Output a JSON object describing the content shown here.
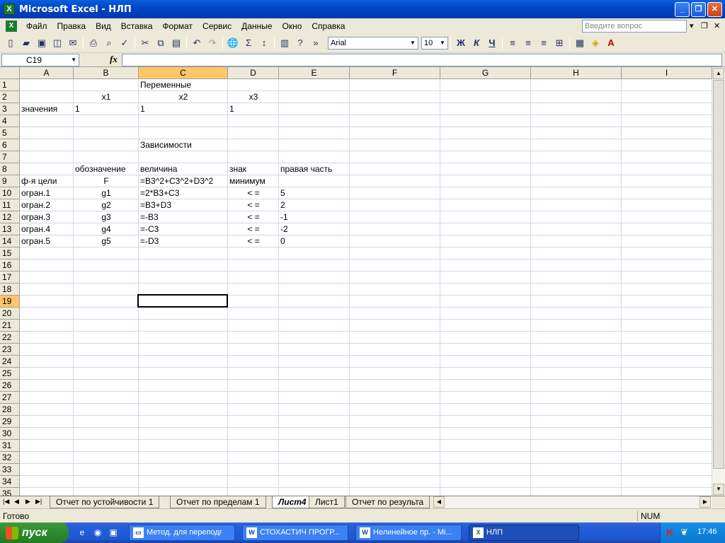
{
  "window": {
    "title": "Microsoft Excel - НЛП",
    "app_icon": "X"
  },
  "menu": {
    "items": [
      "Файл",
      "Правка",
      "Вид",
      "Вставка",
      "Формат",
      "Сервис",
      "Данные",
      "Окно",
      "Справка"
    ],
    "ask_placeholder": "Введите вопрос"
  },
  "toolbar": {
    "font_name": "Arial",
    "font_size": "10",
    "bold_label": "Ж",
    "italic_label": "К",
    "underline_label": "Ч"
  },
  "formula_bar": {
    "name_box": "C19",
    "fx_label": "fx",
    "formula": ""
  },
  "columns": [
    "A",
    "B",
    "C",
    "D",
    "E",
    "F",
    "G",
    "H",
    "I"
  ],
  "selected_column": "C",
  "selected_row": 19,
  "row_count": 35,
  "cells": [
    {
      "ref": "C1",
      "text": "Переменные",
      "align": "left"
    },
    {
      "ref": "B2",
      "text": "x1",
      "align": "center"
    },
    {
      "ref": "C2",
      "text": "x2",
      "align": "center"
    },
    {
      "ref": "D2",
      "text": "x3",
      "align": "center"
    },
    {
      "ref": "A3",
      "text": "значения",
      "align": "left"
    },
    {
      "ref": "B3",
      "text": "1",
      "align": "left"
    },
    {
      "ref": "C3",
      "text": "1",
      "align": "left"
    },
    {
      "ref": "D3",
      "text": "1",
      "align": "left"
    },
    {
      "ref": "C6",
      "text": "Зависимости",
      "align": "left"
    },
    {
      "ref": "B8",
      "text": "обозначение",
      "align": "left"
    },
    {
      "ref": "C8",
      "text": "величина",
      "align": "left"
    },
    {
      "ref": "D8",
      "text": "знак",
      "align": "left"
    },
    {
      "ref": "E8",
      "text": "правая часть",
      "align": "left"
    },
    {
      "ref": "A9",
      "text": "ф-я цели",
      "align": "left"
    },
    {
      "ref": "B9",
      "text": "F",
      "align": "center"
    },
    {
      "ref": "C9",
      "text": "=B3^2+C3^2+D3^2",
      "align": "left"
    },
    {
      "ref": "D9",
      "text": "минимум",
      "align": "left"
    },
    {
      "ref": "A10",
      "text": "огран.1",
      "align": "left"
    },
    {
      "ref": "B10",
      "text": "g1",
      "align": "center"
    },
    {
      "ref": "C10",
      "text": "=2*B3+C3",
      "align": "left"
    },
    {
      "ref": "D10",
      "text": "< =",
      "align": "center"
    },
    {
      "ref": "E10",
      "text": "5",
      "align": "left"
    },
    {
      "ref": "A11",
      "text": "огран.2",
      "align": "left"
    },
    {
      "ref": "B11",
      "text": "g2",
      "align": "center"
    },
    {
      "ref": "C11",
      "text": "=B3+D3",
      "align": "left"
    },
    {
      "ref": "D11",
      "text": "< =",
      "align": "center"
    },
    {
      "ref": "E11",
      "text": "2",
      "align": "left"
    },
    {
      "ref": "A12",
      "text": "огран.3",
      "align": "left"
    },
    {
      "ref": "B12",
      "text": "g3",
      "align": "center"
    },
    {
      "ref": "C12",
      "text": "=-B3",
      "align": "left"
    },
    {
      "ref": "D12",
      "text": "< =",
      "align": "center"
    },
    {
      "ref": "E12",
      "text": "-1",
      "align": "left"
    },
    {
      "ref": "A13",
      "text": "огран.4",
      "align": "left"
    },
    {
      "ref": "B13",
      "text": "g4",
      "align": "center"
    },
    {
      "ref": "C13",
      "text": "=-C3",
      "align": "left"
    },
    {
      "ref": "D13",
      "text": "< =",
      "align": "center"
    },
    {
      "ref": "E13",
      "text": "-2",
      "align": "left"
    },
    {
      "ref": "A14",
      "text": "огран.5",
      "align": "left"
    },
    {
      "ref": "B14",
      "text": "g5",
      "align": "center"
    },
    {
      "ref": "C14",
      "text": "=-D3",
      "align": "left"
    },
    {
      "ref": "D14",
      "text": "< =",
      "align": "center"
    },
    {
      "ref": "E14",
      "text": "0",
      "align": "left"
    }
  ],
  "sheet_tabs": [
    {
      "label": "Отчет по устойчивости 1",
      "active": false
    },
    {
      "label": "Отчет по пределам 1",
      "active": false
    },
    {
      "label": "Лист4",
      "active": true
    },
    {
      "label": "Лист1",
      "active": false
    },
    {
      "label": "Отчет по результа",
      "active": false
    }
  ],
  "status": {
    "text": "Готово",
    "num": "NUM"
  },
  "taskbar": {
    "start_label": "пуск",
    "tasks": [
      {
        "label": "Метод. для переподг",
        "icon": "folder-icon",
        "active": false
      },
      {
        "label": "СТОХАСТИЧ ПРОГР...",
        "icon": "word-icon",
        "active": false
      },
      {
        "label": "Нелинейное пр. - Mi...",
        "icon": "word-icon",
        "active": false
      },
      {
        "label": "НЛП",
        "icon": "excel-icon",
        "active": true
      }
    ],
    "clock": "17:46"
  },
  "colors": {
    "selection_header": "#ffc669",
    "title_bar": "#0047c8",
    "gridline": "#d0d7e5"
  }
}
